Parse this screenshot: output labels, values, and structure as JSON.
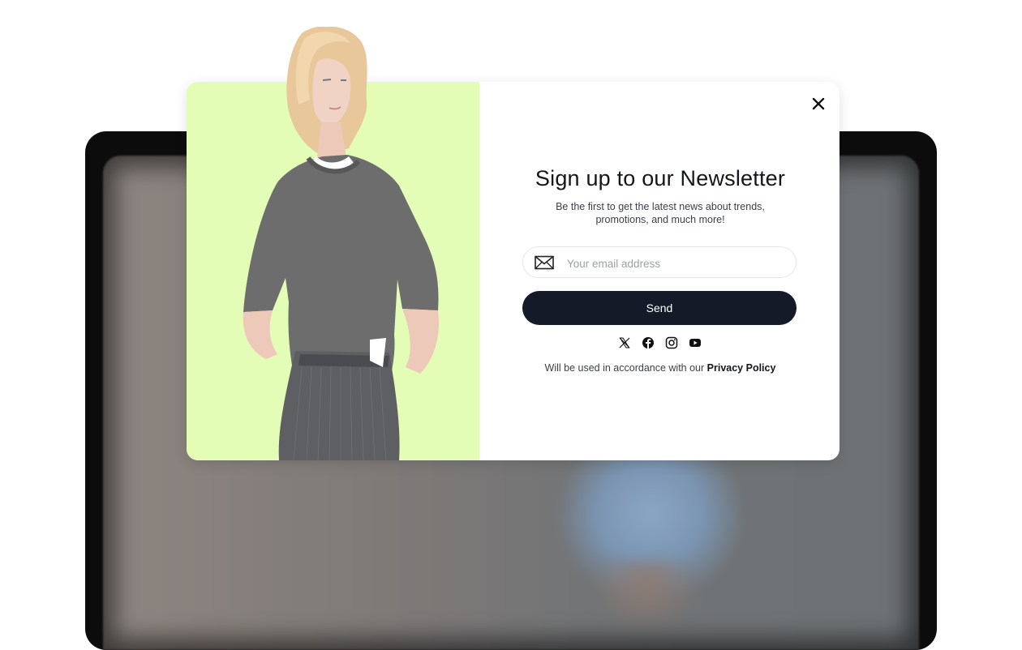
{
  "popup": {
    "title": "Sign up to our Newsletter",
    "subtitle": "Be the first to get the latest news about trends, promotions, and much more!",
    "email_placeholder": "Your email address",
    "email_value": "",
    "send_label": "Send",
    "policy_text": "Will be used in accordance with our ",
    "policy_link": "Privacy Policy",
    "social_icons": [
      "x-icon",
      "facebook-icon",
      "instagram-icon",
      "youtube-icon"
    ],
    "close_icon": "close-icon"
  },
  "colors": {
    "accent_panel": "#e3fcb6",
    "button": "#141a28",
    "text": "#14161d"
  }
}
